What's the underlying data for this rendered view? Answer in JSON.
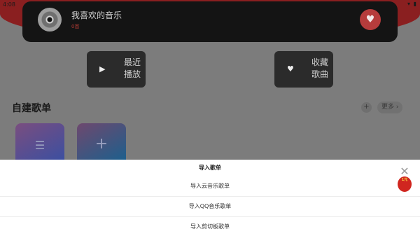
{
  "status": {
    "time": "4:08",
    "icons": "▾ ▮"
  },
  "now_playing": {
    "title": "我喜欢的音乐",
    "subtitle": "0首",
    "heart_icon": "heart-icon"
  },
  "quick_actions": {
    "recent": {
      "line1": "最近",
      "line2": "播放"
    },
    "favorites": {
      "line1": "收藏",
      "line2": "歌曲"
    }
  },
  "playlists": {
    "title": "自建歌单",
    "add": "+",
    "more": "更多 ›"
  },
  "sheet": {
    "title": "导入歌单",
    "options": [
      "导入云音乐歌单",
      "导入QQ音乐歌单",
      "导入剪切板歌单"
    ]
  },
  "promo": {
    "close": "✕",
    "badge": "1元"
  },
  "colors": {
    "accent": "#b63c3c",
    "card": "#141414",
    "sheet": "#ffffff"
  }
}
